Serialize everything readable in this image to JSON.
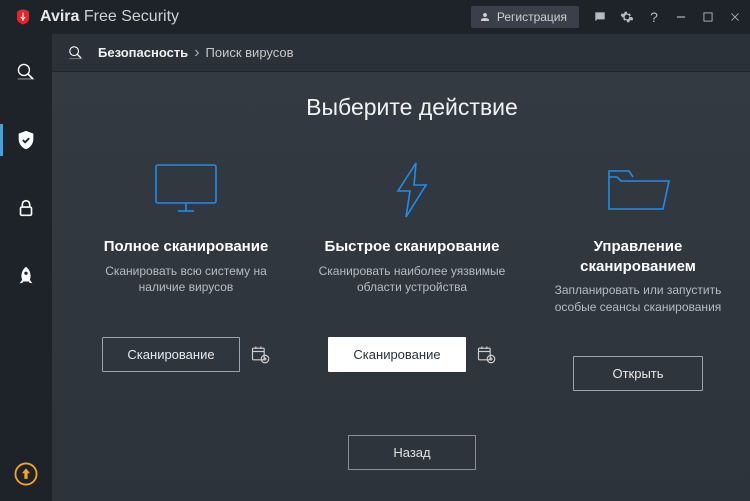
{
  "titlebar": {
    "brand_name": "Avira",
    "product_name": "Free Security",
    "register_label": "Регистрация"
  },
  "breadcrumb": {
    "root": "Безопасность",
    "current": "Поиск вирусов"
  },
  "page": {
    "title": "Выберите действие",
    "back_label": "Назад"
  },
  "cards": [
    {
      "title": "Полное сканирование",
      "desc": "Сканировать всю систему на наличие вирусов",
      "button": "Сканирование"
    },
    {
      "title": "Быстрое сканирование",
      "desc": "Сканировать наиболее уязвимые области устройства",
      "button": "Сканирование"
    },
    {
      "title": "Управление сканированием",
      "desc": "Запланировать или запустить особые сеансы сканирования",
      "button": "Открыть"
    }
  ]
}
